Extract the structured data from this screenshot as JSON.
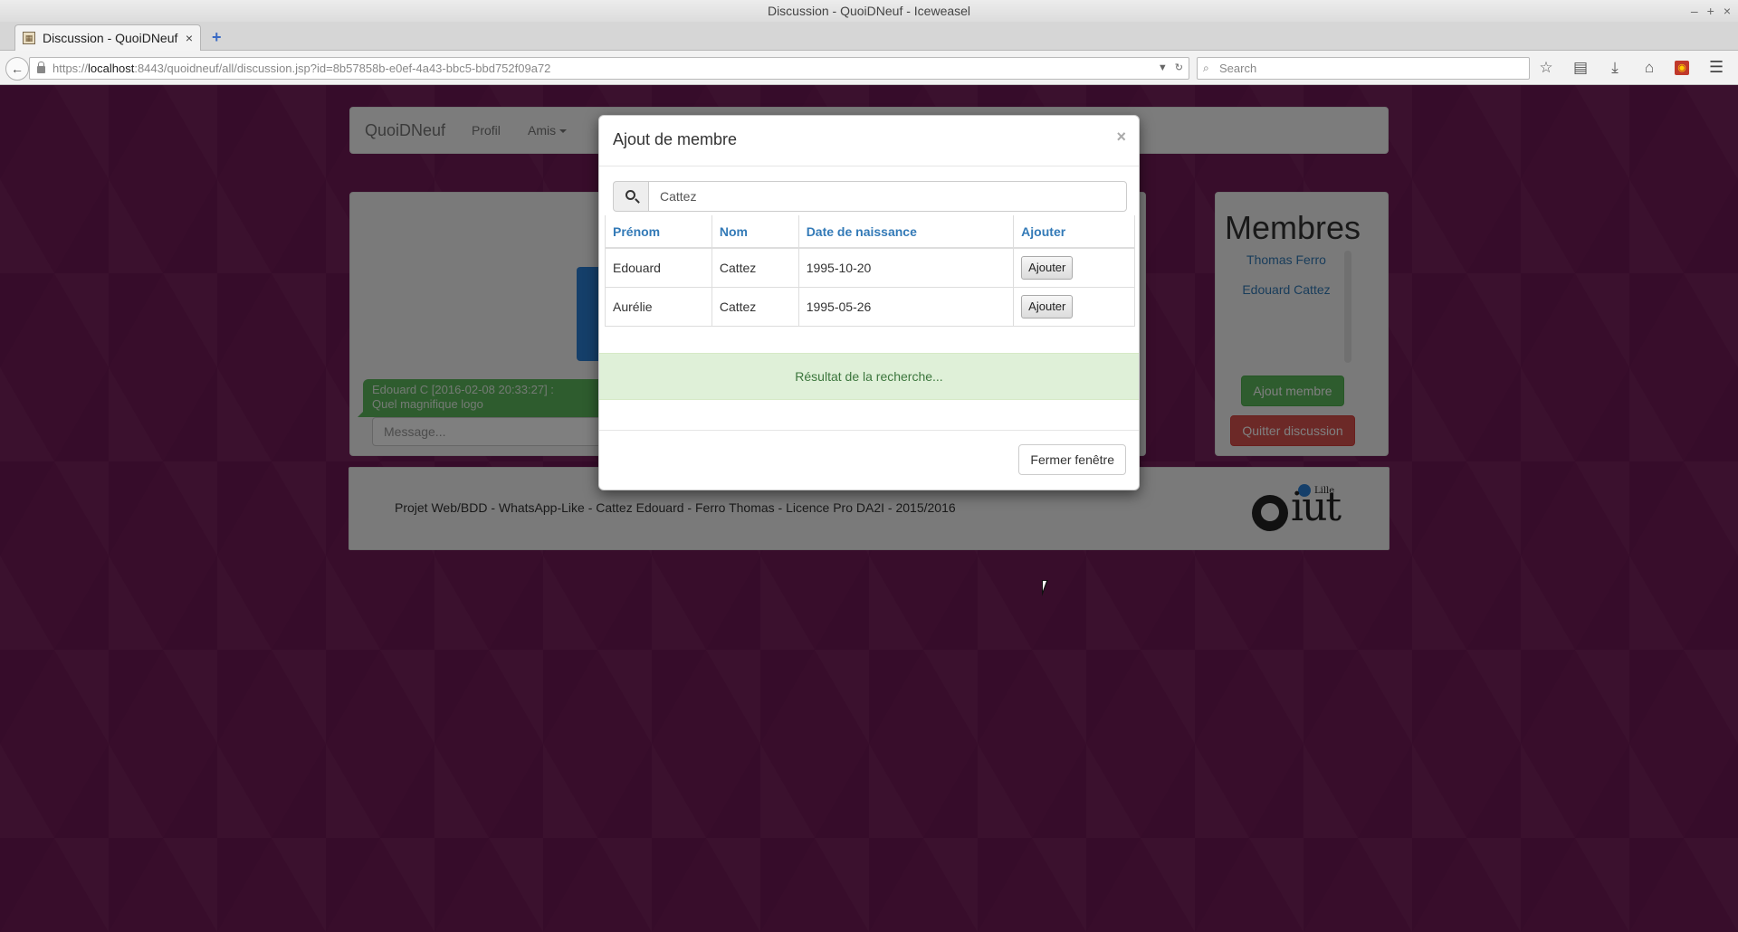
{
  "window": {
    "title": "Discussion - QuoiDNeuf - Iceweasel",
    "controls": [
      "–",
      "+",
      "×"
    ]
  },
  "tab": {
    "title": "Discussion - QuoiDNeuf",
    "close": "×",
    "new_tab": "+"
  },
  "address_bar": {
    "url_prefix": "https://",
    "url_host": "localhost",
    "url_rest": ":8443/quoidneuf/all/discussion.jsp?id=8b57858b-e0ef-4a43-bbc5-bbd752f09a72"
  },
  "search_bar": {
    "placeholder": "Search"
  },
  "site_nav": {
    "brand": "QuoiDNeuf",
    "links": [
      "Profil",
      "Amis"
    ]
  },
  "chat": {
    "message_header": "Edouard C [2016-02-08 20:33:27] :",
    "message_text": "Quel magnifique logo",
    "input_placeholder": "Message..."
  },
  "members": {
    "title": "Membres",
    "list": [
      "Thomas Ferro",
      "Edouard Cattez"
    ],
    "add_button": "Ajout membre",
    "quit_button": "Quitter discussion"
  },
  "footer": {
    "text": "Projet Web/BDD - WhatsApp-Like - Cattez Edouard - Ferro Thomas - Licence Pro DA2I - 2015/2016",
    "logo_text": "iut",
    "logo_sub": "Lille"
  },
  "modal": {
    "title": "Ajout de membre",
    "close": "×",
    "search_value": "Cattez",
    "columns": [
      "Prénom",
      "Nom",
      "Date de naissance",
      "Ajouter"
    ],
    "rows": [
      {
        "prenom": "Edouard",
        "nom": "Cattez",
        "date": "1995-10-20",
        "action": "Ajouter"
      },
      {
        "prenom": "Aurélie",
        "nom": "Cattez",
        "date": "1995-05-26",
        "action": "Ajouter"
      }
    ],
    "result_text": "Résultat de la recherche...",
    "close_button": "Fermer fenêtre"
  }
}
